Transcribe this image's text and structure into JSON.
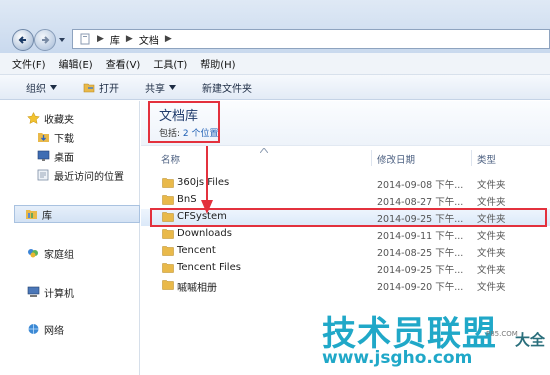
{
  "address": {
    "crumbs": [
      "库",
      "文档"
    ]
  },
  "menu": [
    "文件(F)",
    "编辑(E)",
    "查看(V)",
    "工具(T)",
    "帮助(H)"
  ],
  "toolbar": {
    "organize": "组织",
    "open": "打开",
    "share": "共享",
    "new_folder": "新建文件夹"
  },
  "sidebar": {
    "items": [
      {
        "label": "收藏夹",
        "icon": "star-icon"
      },
      {
        "label": "下载",
        "icon": "download-folder-icon"
      },
      {
        "label": "桌面",
        "icon": "desktop-icon"
      },
      {
        "label": "最近访问的位置",
        "icon": "recent-places-icon"
      },
      {
        "label": "库",
        "icon": "library-icon"
      },
      {
        "label": "家庭组",
        "icon": "homegroup-icon"
      },
      {
        "label": "计算机",
        "icon": "computer-icon"
      },
      {
        "label": "网络",
        "icon": "network-icon"
      }
    ]
  },
  "library": {
    "title": "文档库",
    "includes_label": "包括:",
    "locations": "2 个位置"
  },
  "columns": {
    "name": "名称",
    "modified": "修改日期",
    "type": "类型"
  },
  "files": [
    {
      "name": "360js Files",
      "date": "2014-09-08 下午...",
      "type": "文件夹"
    },
    {
      "name": "BnS",
      "date": "2014-08-27 下午...",
      "type": "文件夹"
    },
    {
      "name": "CFSystem",
      "date": "2014-09-25 下午...",
      "type": "文件夹"
    },
    {
      "name": "Downloads",
      "date": "2014-09-11 下午...",
      "type": "文件夹"
    },
    {
      "name": "Tencent",
      "date": "2014-08-25 下午...",
      "type": "文件夹"
    },
    {
      "name": "Tencent Files",
      "date": "2014-09-25 下午...",
      "type": "文件夹"
    },
    {
      "name": "嘁嘁相册",
      "date": "2014-09-20 下午...",
      "type": "文件夹"
    }
  ],
  "watermark": {
    "title": "技术员联盟",
    "sub": "大全",
    "url": "www.jsgho.com",
    "tiny": "P85.COM"
  },
  "colors": {
    "highlight_red": "#e3313d",
    "watermark_teal": "#20a8c8",
    "folder_yellow": "#e9b94a"
  }
}
